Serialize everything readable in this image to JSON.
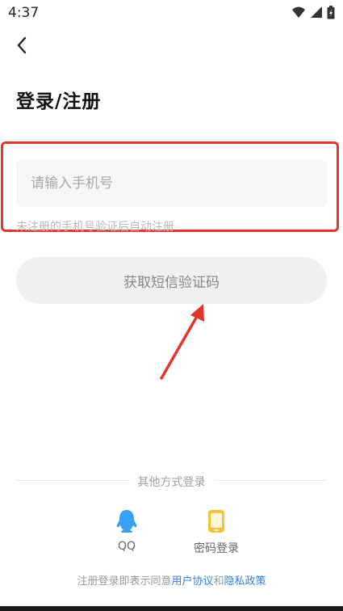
{
  "status_bar": {
    "time": "4:37"
  },
  "header": {
    "title": "登录/注册"
  },
  "phone_input": {
    "placeholder": "请输入手机号",
    "value": ""
  },
  "hint": "未注册的手机号验证后自动注册",
  "sms_button": {
    "label": "获取短信验证码"
  },
  "other_methods": {
    "label": "其他方式登录",
    "options": [
      {
        "label": "QQ",
        "icon": "qq-icon",
        "color": "#3aa0f5"
      },
      {
        "label": "密码登录",
        "icon": "phone-icon",
        "color": "#f5c23a"
      }
    ]
  },
  "agreement": {
    "prefix": "注册登录即表示同意",
    "user_agreement": "用户协议",
    "conjunction": "和",
    "privacy_policy": "隐私政策",
    "link_color": "#2f7fe8"
  },
  "colors": {
    "highlight": "#e0362c",
    "arrow": "#e0362c"
  }
}
